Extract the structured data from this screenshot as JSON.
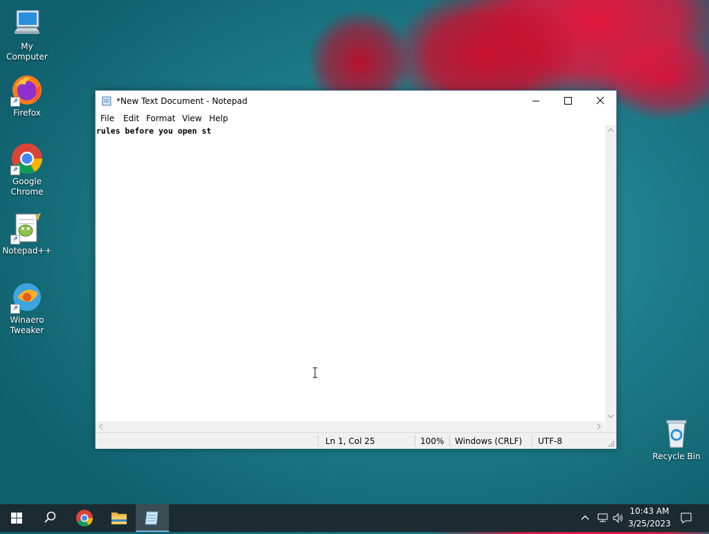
{
  "desktop": {
    "icons": [
      {
        "label": "My Computer",
        "icon": "computer-icon"
      },
      {
        "label": "Firefox",
        "icon": "firefox-icon"
      },
      {
        "label": "Google Chrome",
        "icon": "chrome-icon"
      },
      {
        "label": "Notepad++",
        "icon": "notepadpp-icon"
      },
      {
        "label": "Winaero Tweaker",
        "icon": "winaero-icon"
      },
      {
        "label": "Recycle Bin",
        "icon": "recycle-bin-icon"
      }
    ]
  },
  "window": {
    "title": "*New Text Document - Notepad",
    "menu": [
      "File",
      "Edit",
      "Format",
      "View",
      "Help"
    ],
    "content": "rules before you open st",
    "status": {
      "position": "Ln 1, Col 25",
      "zoom": "100%",
      "line_ending": "Windows (CRLF)",
      "encoding": "UTF-8"
    }
  },
  "taskbar": {
    "time": "10:43 AM",
    "date": "3/25/2023"
  },
  "colors": {
    "taskbar": "#1c2a31",
    "desktop": "#1f7f8c",
    "accent_red": "#c8102e"
  }
}
